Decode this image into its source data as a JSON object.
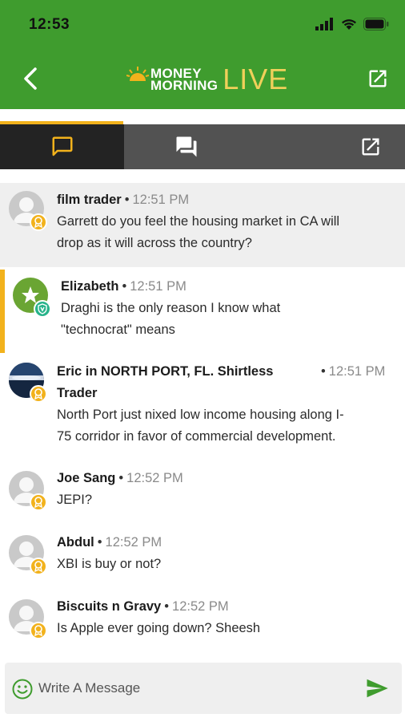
{
  "status_bar": {
    "time": "12:53"
  },
  "header": {
    "logo_top": "MONEY",
    "logo_bottom": "MORNING",
    "logo_live": "LIVE"
  },
  "colors": {
    "brand_green": "#3f9c2e",
    "accent_gold": "#f2b21c",
    "tab_dark": "#232323",
    "tab_gray": "#525252"
  },
  "tabs": [
    {
      "name": "chat",
      "icon": "chat-bubble-icon",
      "active": true
    },
    {
      "name": "qa",
      "icon": "forum-icon",
      "active": false
    },
    {
      "name": "popout",
      "icon": "open-in-new-icon",
      "active": false
    }
  ],
  "messages": [
    {
      "author": "film trader",
      "sep": "•",
      "time": "12:51 PM",
      "lines": [
        "Garrett do you feel the housing market in CA will",
        "drop as it will across the country?"
      ],
      "badge": "gold",
      "avatar": "default"
    },
    {
      "author": "Elizabeth",
      "sep": "•",
      "time": "12:51 PM",
      "lines": [
        "Draghi is the only reason I know what",
        "\"technocrat\" means"
      ],
      "badge": "teal",
      "avatar": "star"
    },
    {
      "author": "Eric in NORTH PORT, FL.  Shirtless",
      "author2": "Trader",
      "sep": "•",
      "time": "12:51 PM",
      "lines": [
        "North Port just nixed low income housing along I-",
        "75 corridor in favor of commercial development."
      ],
      "badge": "gold",
      "avatar": "photo"
    },
    {
      "author": "Joe Sang",
      "sep": "•",
      "time": "12:52 PM",
      "lines": [
        "JEPI?"
      ],
      "badge": "gold",
      "avatar": "default"
    },
    {
      "author": "Abdul",
      "sep": "•",
      "time": "12:52 PM",
      "lines": [
        "XBI is buy or not?"
      ],
      "badge": "gold",
      "avatar": "default"
    },
    {
      "author": "Biscuits n Gravy",
      "sep": "•",
      "time": "12:52 PM",
      "lines": [
        "Is Apple ever going down? Sheesh"
      ],
      "badge": "gold",
      "avatar": "default"
    }
  ],
  "composer": {
    "placeholder": "Write A Message",
    "value": ""
  }
}
